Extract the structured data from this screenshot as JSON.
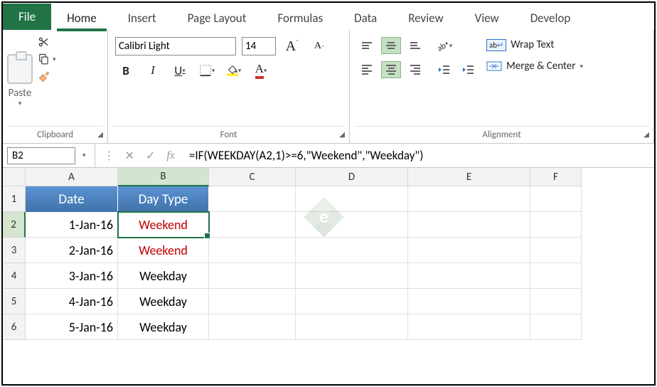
{
  "tabs": {
    "file": "File",
    "home": "Home",
    "insert": "Insert",
    "page_layout": "Page Layout",
    "formulas": "Formulas",
    "data": "Data",
    "review": "Review",
    "view": "View",
    "developer": "Develop"
  },
  "ribbon": {
    "clipboard": {
      "paste": "Paste",
      "label": "Clipboard"
    },
    "font": {
      "name": "Calibri Light",
      "size": "14",
      "bold": "B",
      "italic": "I",
      "underline": "U",
      "label": "Font",
      "grow_A": "A",
      "shrink_A": "A",
      "fill_A": "A",
      "font_color_A": "A"
    },
    "alignment": {
      "wrap": "Wrap Text",
      "merge": "Merge & Center",
      "label": "Alignment",
      "wrap_prefix": "ab",
      "wrap_arrow": "↵"
    }
  },
  "formula_bar": {
    "namebox": "B2",
    "formula": "=IF(WEEKDAY(A2,1)>=6,\"Weekend\",\"Weekday\")",
    "fx": "fx"
  },
  "grid": {
    "cols": [
      "A",
      "B",
      "C",
      "D",
      "E",
      "F"
    ],
    "rows": [
      "1",
      "2",
      "3",
      "4",
      "5",
      "6"
    ],
    "headers": {
      "A": "Date",
      "B": "Day Type"
    },
    "data": [
      {
        "date": "1-Jan-16",
        "type": "Weekend",
        "red": true
      },
      {
        "date": "2-Jan-16",
        "type": "Weekend",
        "red": true
      },
      {
        "date": "3-Jan-16",
        "type": "Weekday",
        "red": false
      },
      {
        "date": "4-Jan-16",
        "type": "Weekday",
        "red": false
      },
      {
        "date": "5-Jan-16",
        "type": "Weekday",
        "red": false
      }
    ]
  }
}
